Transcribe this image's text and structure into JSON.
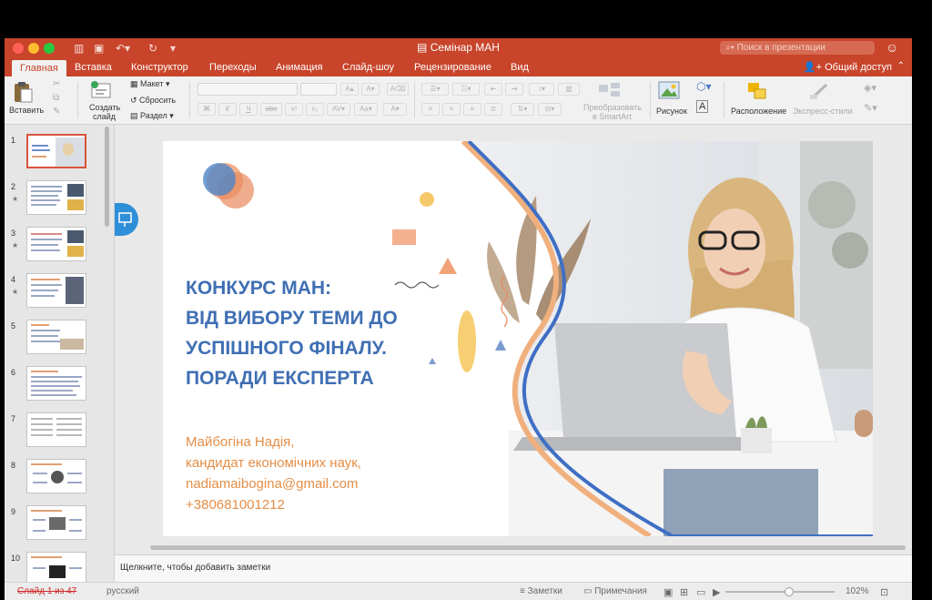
{
  "window": {
    "title": "Семінар МАН",
    "search_placeholder": "Поиск в презентации"
  },
  "ribbon_tabs": [
    {
      "label": "Главная",
      "active": true
    },
    {
      "label": "Вставка"
    },
    {
      "label": "Конструктор"
    },
    {
      "label": "Переходы"
    },
    {
      "label": "Анимация"
    },
    {
      "label": "Слайд-шоу"
    },
    {
      "label": "Рецензирование"
    },
    {
      "label": "Вид"
    }
  ],
  "share_label": "Общий доступ",
  "ribbon": {
    "paste": "Вставить",
    "new_slide_line1": "Создать",
    "new_slide_line2": "слайд",
    "layout": "Макет",
    "reset": "Сбросить",
    "section": "Раздел",
    "smartart_line1": "Преобразовать",
    "smartart_line2": "в SmartArt",
    "picture": "Рисунок",
    "arrange": "Расположение",
    "quick_styles": "Экспресс-стили"
  },
  "thumbnails": [
    {
      "num": "1",
      "star": false,
      "selected": true
    },
    {
      "num": "2",
      "star": true
    },
    {
      "num": "3",
      "star": true
    },
    {
      "num": "4",
      "star": true
    },
    {
      "num": "5",
      "star": false
    },
    {
      "num": "6",
      "star": false
    },
    {
      "num": "7",
      "star": false
    },
    {
      "num": "8",
      "star": false
    },
    {
      "num": "9",
      "star": false
    },
    {
      "num": "10",
      "star": false
    }
  ],
  "slide": {
    "title_lines": [
      "КОНКУРС МАН:",
      "ВІД ВИБОРУ ТЕМИ ДО",
      "УСПІШНОГО ФІНАЛУ.",
      "ПОРАДИ ЕКСПЕРТА"
    ],
    "author_lines": [
      "Майбогіна Надія,",
      "кандидат економічних наук,",
      "nadiamaibogina@gmail.com",
      "+380681001212"
    ]
  },
  "notes_placeholder": "Щелкните, чтобы добавить заметки",
  "status": {
    "slide_info": "Слайд 1 из 47",
    "language": "русский",
    "notes_btn": "Заметки",
    "comments_btn": "Примечания",
    "zoom": "102%"
  },
  "colors": {
    "accent": "#c8442a",
    "title_blue": "#3f6fb3",
    "author_orange": "#e48e47"
  }
}
